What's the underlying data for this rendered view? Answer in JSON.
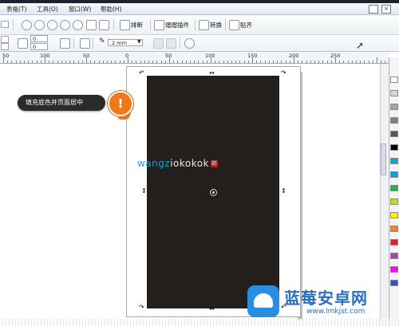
{
  "menu": {
    "items": [
      "表格(T)",
      "工具(O)",
      "窗口(W)",
      "帮助(H)"
    ]
  },
  "toolbar": {
    "layout_label": "排断",
    "plugin_label": "熠熠插件",
    "convert_label": "转换",
    "paste_label": "贴齐"
  },
  "property_bar": {
    "field_top": "0",
    "field_bottom": "0",
    "outline_width": ".2 mm"
  },
  "ruler": {
    "labels": [
      "50",
      "100",
      "50",
      "0",
      "50",
      "100",
      "150",
      "200",
      "250"
    ]
  },
  "artwork": {
    "logo_part1": "wangz",
    "logo_part2": "iokokok",
    "rect_color": "#221f1d"
  },
  "callout": {
    "text": "填充底色并页面居中",
    "icon_glyph": "!"
  },
  "watermark": {
    "title": "蓝莓安卓网",
    "url": "www.lmkjst.com"
  },
  "colors": {
    "accent_orange": "#f07a1a",
    "logo_blue": "#1f9fc8",
    "palette": [
      "#ffffff",
      "#d9d9d9",
      "#a6a6a6",
      "#808080",
      "#595959",
      "#000000",
      "#1f9fc8",
      "#00a2e8",
      "#22b14c",
      "#b5e61d",
      "#fff200",
      "#ff7f27",
      "#ed1c24",
      "#a349a4",
      "#ff00ff",
      "#3f48cc"
    ]
  }
}
